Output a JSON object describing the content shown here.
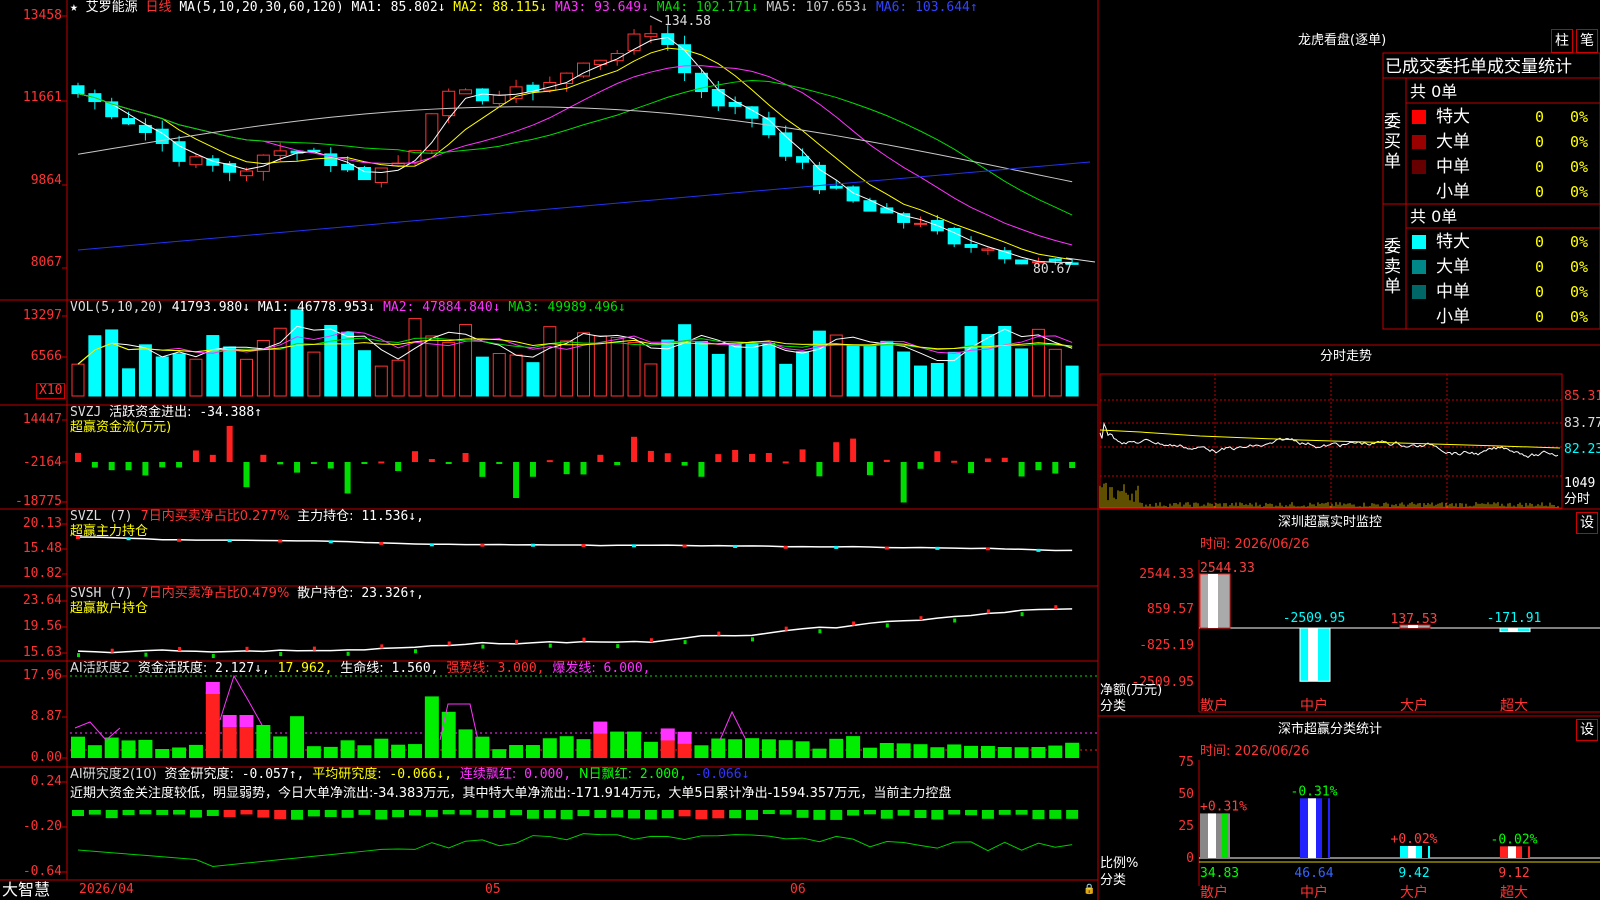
{
  "stock": {
    "star": "★",
    "name": "艾罗能源",
    "period": "日线",
    "ma_header": "MA(5,10,20,30,60,120)",
    "ma_values": [
      {
        "label": "MA1:",
        "value": "85.802↓",
        "color": "#ffffff"
      },
      {
        "label": "MA2:",
        "value": "88.115↓",
        "color": "#ffff00"
      },
      {
        "label": "MA3:",
        "value": "93.649↓",
        "color": "#ff33ff"
      },
      {
        "label": "MA4:",
        "value": "102.171↓",
        "color": "#00dd00"
      },
      {
        "label": "MA5:",
        "value": "107.653↓",
        "color": "#c8c8c8"
      },
      {
        "label": "MA6:",
        "value": "103.644↑",
        "color": "#3344ff"
      }
    ],
    "high_mark": "134.58",
    "low_mark": "80.67",
    "price_ticks": [
      "13458",
      "11661",
      "9864",
      "8067"
    ]
  },
  "vol": {
    "header": "VOL(5,10,20)",
    "value": "41793.980↓",
    "mas": [
      {
        "label": "MA1:",
        "value": "46778.953↓",
        "color": "#ffffff"
      },
      {
        "label": "MA2:",
        "value": "47884.840↓",
        "color": "#ff33ff"
      },
      {
        "label": "MA3:",
        "value": "49989.496↓",
        "color": "#00dd00"
      }
    ],
    "ticks": [
      "13297",
      "6566"
    ],
    "unit": "X10"
  },
  "svzj": {
    "name": "SVZJ",
    "label": "活跃资金进出:",
    "value": "-34.388↑",
    "subtitle": "超赢资金流(万元)",
    "ticks": [
      "14447",
      "-2164",
      "-18775"
    ]
  },
  "svzl": {
    "name": "SVZL (7)",
    "label1": "7日内买卖净占比0.277%",
    "label2": "主力持仓:",
    "value": "11.536↓,",
    "subtitle": "超赢主力持仓",
    "ticks": [
      "20.13",
      "15.48",
      "10.82"
    ]
  },
  "svsh": {
    "name": "SVSH (7)",
    "label1": "7日内买卖净占比0.479%",
    "label2": "散户持仓:",
    "value": "23.326↑,",
    "subtitle": "超赢散户持仓",
    "ticks": [
      "23.64",
      "19.56",
      "15.63"
    ]
  },
  "ai_active": {
    "name": "AI活跃度2",
    "label1": "资金活跃度:",
    "value1": "2.127↓,",
    "value2": "17.962,",
    "label3": "生命线:",
    "value3": "1.560,",
    "label4": "强势线:",
    "value4": "3.000,",
    "label5": "爆发线:",
    "value5": "6.000,",
    "ticks": [
      "17.96",
      "8.87",
      "0.00"
    ]
  },
  "ai_research": {
    "name": "AI研究度2(10)",
    "label1": "资金研究度:",
    "value1": "-0.057↑,",
    "label2": "平均研究度:",
    "value2": "-0.066↓,",
    "label3": "连续飘红:",
    "value3": "0.000,",
    "label4": "N日飘红:",
    "value4": "2.000,",
    "value5": "-0.066↓",
    "comment": "近期大资金关注度较低，明显弱势，今日大单净流出:-34.383万元，其中特大单净流出:-171.914万元，大单5日累计净出-1594.357万元，当前主力控盘",
    "ticks": [
      "0.24",
      "-0.20",
      "-0.64"
    ]
  },
  "bottom": {
    "brand": "大智慧",
    "dates": [
      "2026/04",
      "05",
      "06"
    ]
  },
  "dragon": {
    "title": "龙虎看盘(逐单)",
    "btn1": "柱",
    "btn2": "笔",
    "header": "已成交委托单成交量统计",
    "buy_label": "委买单",
    "sell_label": "委卖单",
    "buy_count": "共 0单",
    "sell_count": "共 0单",
    "buy_rows": [
      {
        "name": "特大",
        "qty": "0",
        "pct": "0%",
        "color": "#ff0000"
      },
      {
        "name": "大单",
        "qty": "0",
        "pct": "0%",
        "color": "#990000"
      },
      {
        "name": "中单",
        "qty": "0",
        "pct": "0%",
        "color": "#660000"
      },
      {
        "name": "小单",
        "qty": "0",
        "pct": "0%",
        "color": "#000000"
      }
    ],
    "sell_rows": [
      {
        "name": "特大",
        "qty": "0",
        "pct": "0%",
        "color": "#00ffff"
      },
      {
        "name": "大单",
        "qty": "0",
        "pct": "0%",
        "color": "#008888"
      },
      {
        "name": "中单",
        "qty": "0",
        "pct": "0%",
        "color": "#006666"
      },
      {
        "name": "小单",
        "qty": "0",
        "pct": "0%",
        "color": "#000000"
      }
    ]
  },
  "intraday": {
    "title": "分时走势",
    "ticks": [
      "85.31",
      "83.77",
      "82.23"
    ],
    "vol_tick": "1049",
    "unit": "分时"
  },
  "monitor": {
    "title": "深圳超赢实时监控",
    "set_btn": "设",
    "time": "时间: 2026/06/26",
    "ylabel": "净额(万元)",
    "xlabel": "分类",
    "ticks": [
      "2544.33",
      "859.57",
      "-825.19",
      "-2509.95"
    ],
    "categories": [
      "散户",
      "中户",
      "大户",
      "超大"
    ],
    "values": [
      2544.33,
      -2509.95,
      137.53,
      -171.91
    ],
    "value_labels": [
      "2544.33",
      "-2509.95",
      "137.53",
      "-171.91"
    ]
  },
  "classify": {
    "title": "深市超赢分类统计",
    "set_btn": "设",
    "time": "时间: 2026/06/26",
    "ylabel": "比例%",
    "xlabel": "分类",
    "ticks": [
      "75",
      "50",
      "25",
      "0"
    ],
    "categories": [
      "散户",
      "中户",
      "大户",
      "超大"
    ],
    "values": [
      34.83,
      46.64,
      9.42,
      9.12
    ],
    "value_labels": [
      "34.83",
      "46.64",
      "9.42",
      "9.12"
    ],
    "change_labels": [
      "+0.31%",
      "-0.31%",
      "+0.02%",
      "-0.02%"
    ]
  },
  "colors": {
    "up": "#ff3333",
    "down": "#00ffff",
    "border": "#c00000",
    "ma1": "#ffffff",
    "ma2": "#ffff00",
    "ma3": "#ff33ff",
    "ma4": "#00dd00",
    "ma5": "#c8c8c8",
    "ma6": "#2233ee"
  }
}
